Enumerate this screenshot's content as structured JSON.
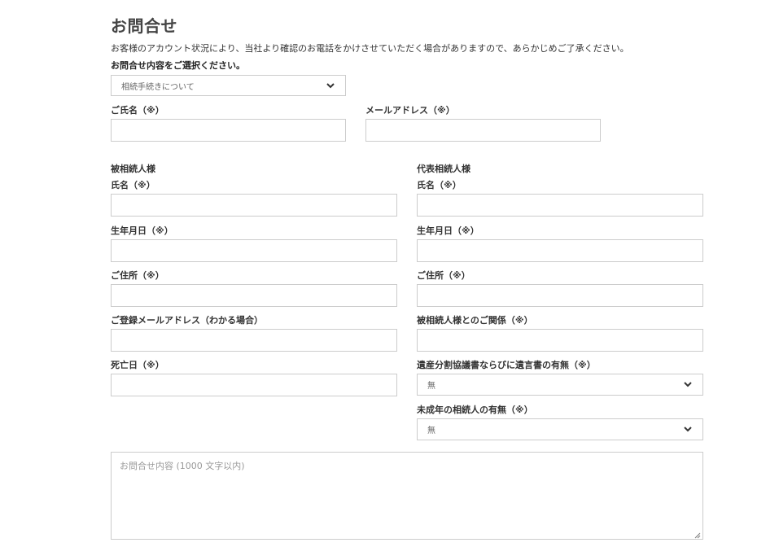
{
  "page": {
    "title": "お問合せ",
    "notice": "お客様のアカウント状況により、当社より確認のお電話をかけさせていただく場合がありますので、あらかじめご了承ください。",
    "select_label": "お問合せ内容をご選択ください。"
  },
  "inquiry_type": {
    "value": "相続手続きについて",
    "icon": "chevron-down-icon"
  },
  "contact": {
    "name_label": "ご氏名（※）",
    "name_value": "",
    "email_label": "メールアドレス（※）",
    "email_value": ""
  },
  "deceased": {
    "section_title": "被相続人様",
    "fields": [
      {
        "label": "氏名（※）",
        "value": ""
      },
      {
        "label": "生年月日（※）",
        "value": ""
      },
      {
        "label": "ご住所（※）",
        "value": ""
      },
      {
        "label": "ご登録メールアドレス（わかる場合）",
        "value": ""
      },
      {
        "label": "死亡日（※）",
        "value": ""
      }
    ]
  },
  "representative": {
    "section_title": "代表相続人様",
    "fields": [
      {
        "label": "氏名（※）",
        "value": ""
      },
      {
        "label": "生年月日（※）",
        "value": ""
      },
      {
        "label": "ご住所（※）",
        "value": ""
      },
      {
        "label": "被相続人様とのご関係（※）",
        "value": ""
      }
    ],
    "will_select": {
      "label": "遺産分割協議書ならびに遺言書の有無（※）",
      "value": "無"
    },
    "minor_select": {
      "label": "未成年の相続人の有無（※）",
      "value": "無"
    }
  },
  "message": {
    "placeholder": "お問合せ内容 (1000 文字以内)",
    "value": ""
  },
  "colors": {
    "border": "#cccccc",
    "title": "#444444",
    "text": "#333333",
    "placeholder": "#999999"
  }
}
